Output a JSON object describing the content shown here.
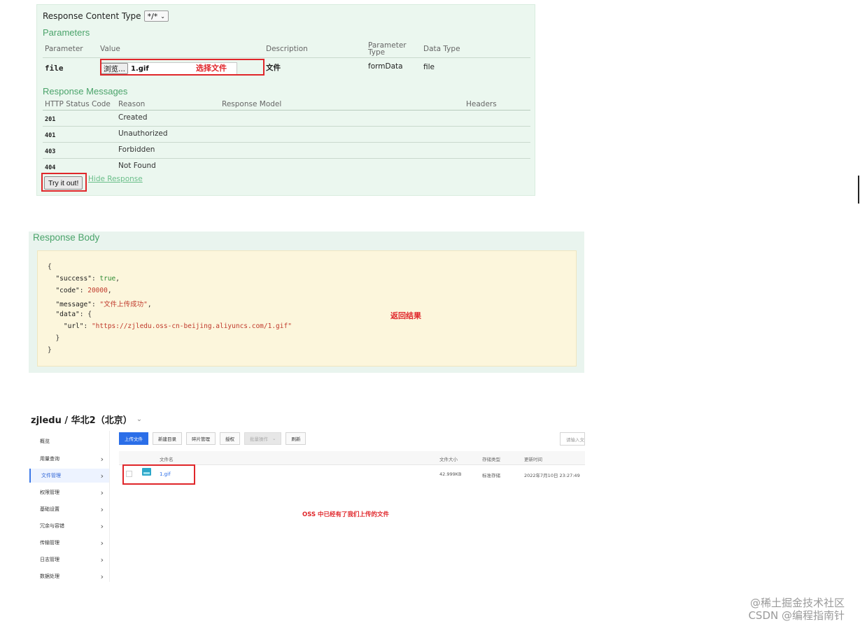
{
  "swagger": {
    "response_content_type_label": "Response Content Type",
    "response_content_type_value": "*/*",
    "parameters_heading": "Parameters",
    "param_headers": [
      "Parameter",
      "Value",
      "Description",
      "Parameter Type",
      "Data Type"
    ],
    "param_row": {
      "name": "file",
      "browse_label": "浏览...",
      "file_name": "1.gif",
      "annotation": "选择文件",
      "description": "文件",
      "param_type": "formData",
      "data_type": "file"
    },
    "response_messages_heading": "Response Messages",
    "resp_headers": [
      "HTTP Status Code",
      "Reason",
      "Response Model",
      "Headers"
    ],
    "resp_rows": [
      {
        "code": "201",
        "reason": "Created"
      },
      {
        "code": "401",
        "reason": "Unauthorized"
      },
      {
        "code": "403",
        "reason": "Forbidden"
      },
      {
        "code": "404",
        "reason": "Not Found"
      }
    ],
    "try_button": "Try it out!",
    "hide_response": "Hide Response"
  },
  "response_body": {
    "title": "Response Body",
    "annotation": "返回结果",
    "json_lines": {
      "l1": "{",
      "success_key": "\"success\"",
      "success_val": "true",
      "code_key": "\"code\"",
      "code_val": "20000",
      "message_key": "\"message\"",
      "message_val": "\"文件上传成功\"",
      "data_key": "\"data\"",
      "url_key": "\"url\"",
      "url_val": "\"https://zjledu.oss-cn-beijing.aliyuncs.com/1.gif\"",
      "close_inner": "}",
      "close_outer": "}"
    }
  },
  "oss": {
    "title": "zjledu / 华北2（北京）",
    "sidebar": [
      {
        "label": "概览",
        "arrow": false,
        "active": false
      },
      {
        "label": "用量查询",
        "arrow": true,
        "active": false
      },
      {
        "label": "文件管理",
        "arrow": true,
        "active": true
      },
      {
        "label": "权限管理",
        "arrow": true,
        "active": false
      },
      {
        "label": "基础设置",
        "arrow": true,
        "active": false
      },
      {
        "label": "冗余与容错",
        "arrow": true,
        "active": false
      },
      {
        "label": "传输管理",
        "arrow": true,
        "active": false
      },
      {
        "label": "日志管理",
        "arrow": true,
        "active": false
      },
      {
        "label": "数据处理",
        "arrow": true,
        "active": false
      }
    ],
    "toolbar": {
      "upload": "上传文件",
      "new_dir": "新建目录",
      "fragments": "碎片管理",
      "authorize": "授权",
      "batch": "批量操作",
      "refresh": "刷新"
    },
    "search_placeholder": "请输入文件名",
    "table_headers": {
      "name": "文件名",
      "size": "文件大小",
      "storage": "存储类型",
      "updated": "更新时间"
    },
    "file_row": {
      "name": "1.gif",
      "size": "42.999KB",
      "storage": "标准存储",
      "updated": "2022年7月10日 23:27:49"
    },
    "annotation": "OSS 中已经有了我们上传的文件"
  },
  "watermark": {
    "line1": "@稀土掘金技术社区",
    "line2": "CSDN @编程指南针"
  },
  "colors": {
    "green_heading": "#4aa36a",
    "annotation_red": "#e0262a",
    "oss_primary": "#2b6ee8"
  }
}
